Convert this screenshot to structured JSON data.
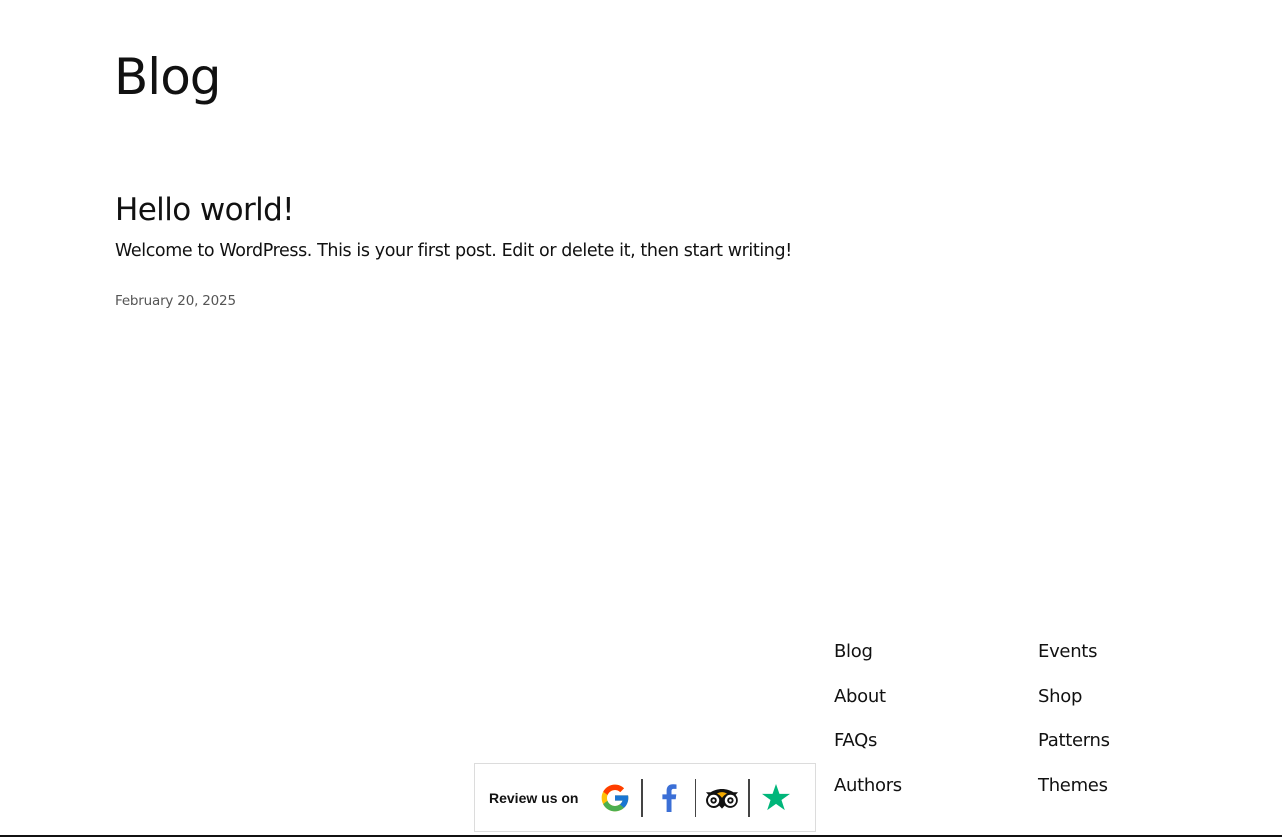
{
  "page": {
    "title": "Blog"
  },
  "post": {
    "title": "Hello world!",
    "excerpt": "Welcome to WordPress. This is your first post. Edit or delete it, then start writing!",
    "date": "February 20, 2025"
  },
  "footer_nav": {
    "col1": [
      "Blog",
      "About",
      "FAQs",
      "Authors"
    ],
    "col2": [
      "Events",
      "Shop",
      "Patterns",
      "Themes"
    ]
  },
  "review_widget": {
    "label": "Review us on",
    "platforms": [
      "google-icon",
      "facebook-icon",
      "tripadvisor-icon",
      "trustpilot-star-icon"
    ],
    "colors": {
      "google_blue": "#4285F4",
      "google_red": "#EA4335",
      "google_yellow": "#FBBC05",
      "google_green": "#34A853",
      "facebook": "#3b6fd6",
      "trustpilot": "#00B67A"
    }
  }
}
